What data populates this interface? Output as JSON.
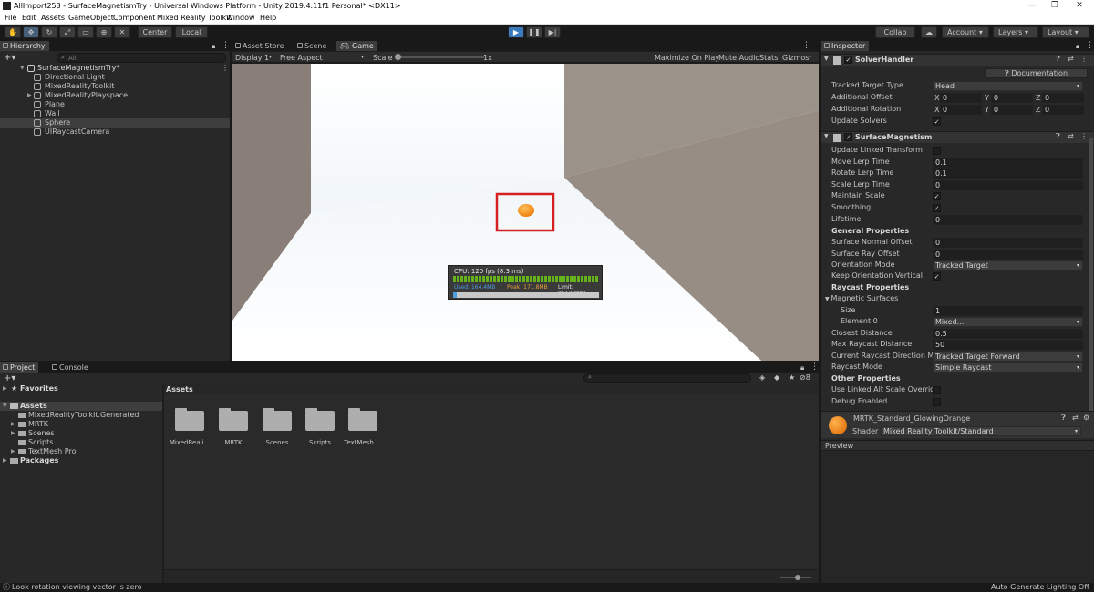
{
  "window": {
    "title": "AllImport253 - SurfaceMagnetismTry - Universal Windows Platform - Unity 2019.4.11f1 Personal* <DX11>",
    "controls": [
      "—",
      "❐",
      "✕"
    ]
  },
  "menu": [
    "File",
    "Edit",
    "Assets",
    "GameObject",
    "Component",
    "Mixed Reality Toolkit",
    "Window",
    "Help"
  ],
  "toolbar": {
    "pivot": "Center",
    "space": "Local",
    "collab": "Collab",
    "account": "Account",
    "layers": "Layers",
    "layout": "Layout"
  },
  "hierarchy": {
    "tab": "Hierarchy",
    "search_placeholder": "All",
    "scene": "SurfaceMagnetismTry*",
    "items": [
      "Directional Light",
      "MixedRealityToolkit",
      "MixedRealityPlayspace",
      "Plane",
      "Wall",
      "Sphere",
      "UIRaycastCamera"
    ]
  },
  "game": {
    "tabs": [
      "Asset Store",
      "Scene",
      "Game"
    ],
    "display": "Display 1",
    "aspect": "Free Aspect",
    "scale_label": "Scale",
    "scale_value": "1x",
    "maximize": "Maximize On Play",
    "mute": "Mute Audio",
    "stats": "Stats",
    "gizmos": "Gizmos",
    "profiler": {
      "cpu": "CPU: 120 fps (8.3 ms)",
      "used": "Used: 164.4MB",
      "peak": "Peak: 171.8MB",
      "limit": "Limit: 8112.0MB"
    }
  },
  "inspector": {
    "tab": "Inspector",
    "solver": {
      "name": "SolverHandler",
      "documentation": "Documentation",
      "tracked_label": "Tracked Target Type",
      "tracked_value": "Head",
      "offset_label": "Additional Offset",
      "rotation_label": "Additional Rotation",
      "vec_x": "X",
      "vec_y": "Y",
      "vec_z": "Z",
      "zero": "0",
      "update_label": "Update Solvers"
    },
    "magnetism": {
      "name": "SurfaceMagnetism",
      "rows": [
        {
          "label": "Update Linked Transform",
          "value": ""
        },
        {
          "label": "Move Lerp Time",
          "value": "0.1"
        },
        {
          "label": "Rotate Lerp Time",
          "value": "0.1"
        },
        {
          "label": "Scale Lerp Time",
          "value": "0"
        },
        {
          "label": "Maintain Scale",
          "value": "✓"
        },
        {
          "label": "Smoothing",
          "value": "✓"
        },
        {
          "label": "Lifetime",
          "value": "0"
        }
      ],
      "general": "General Properties",
      "general_rows": [
        {
          "label": "Surface Normal Offset",
          "value": "0"
        },
        {
          "label": "Surface Ray Offset",
          "value": "0"
        },
        {
          "label": "Orientation Mode",
          "value": "Tracked Target"
        },
        {
          "label": "Keep Orientation Vertical",
          "value": "✓"
        }
      ],
      "raycast": "Raycast Properties",
      "magnetic": "Magnetic Surfaces",
      "size_label": "Size",
      "size_value": "1",
      "element_label": "Element 0",
      "element_value": "Mixed...",
      "raycast_rows": [
        {
          "label": "Closest Distance",
          "value": "0.5"
        },
        {
          "label": "Max Raycast Distance",
          "value": "50"
        },
        {
          "label": "Current Raycast Direction Mode",
          "value": "Tracked Target Forward"
        },
        {
          "label": "Raycast Mode",
          "value": "Simple Raycast"
        }
      ],
      "other": "Other Properties",
      "other_rows": [
        {
          "label": "Use Linked Alt Scale Override",
          "value": ""
        },
        {
          "label": "Debug Enabled",
          "value": ""
        }
      ]
    },
    "material": {
      "name": "MRTK_Standard_GlowingOrange",
      "shader_label": "Shader",
      "shader_value": "Mixed Reality Toolkit/Standard"
    },
    "preview": "Preview"
  },
  "project": {
    "tabs": [
      "Project",
      "Console"
    ],
    "favorites": "Favorites",
    "assets_root": "Assets",
    "tree": [
      "MixedRealityToolkit.Generated",
      "MRTK",
      "Scenes",
      "Scripts",
      "TextMesh Pro"
    ],
    "packages": "Packages",
    "breadcrumb": "Assets",
    "hidden_count": "8",
    "folders": [
      "MixedReali...",
      "MRTK",
      "Scenes",
      "Scripts",
      "TextMesh ..."
    ]
  },
  "status": {
    "message": "Look rotation viewing vector is zero",
    "right": "Auto Generate Lighting Off"
  }
}
